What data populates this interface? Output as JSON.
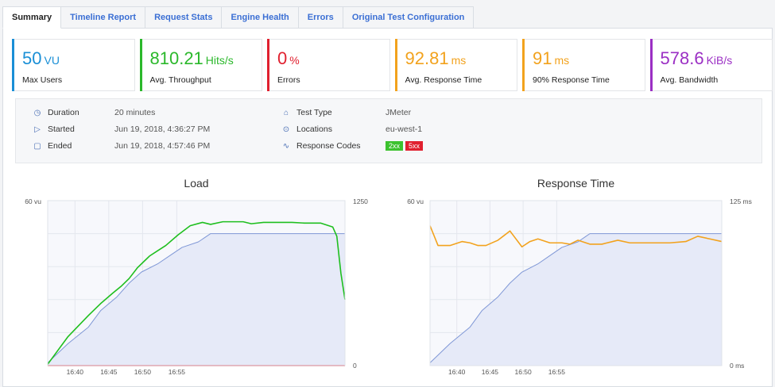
{
  "tabs": [
    {
      "label": "Summary",
      "active": true
    },
    {
      "label": "Timeline Report",
      "active": false
    },
    {
      "label": "Request Stats",
      "active": false
    },
    {
      "label": "Engine Health",
      "active": false
    },
    {
      "label": "Errors",
      "active": false
    },
    {
      "label": "Original Test Configuration",
      "active": false
    }
  ],
  "metrics": [
    {
      "value": "50",
      "unit": "VU",
      "label": "Max Users",
      "color": "#1a8fd6"
    },
    {
      "value": "810.21",
      "unit": "Hits/s",
      "label": "Avg. Throughput",
      "color": "#2bb82b"
    },
    {
      "value": "0",
      "unit": "%",
      "label": "Errors",
      "color": "#e0202f"
    },
    {
      "value": "92.81",
      "unit": "ms",
      "label": "Avg. Response Time",
      "color": "#f2a21d"
    },
    {
      "value": "91",
      "unit": "ms",
      "label": "90% Response Time",
      "color": "#f2a21d"
    },
    {
      "value": "578.6",
      "unit": "KiB/s",
      "label": "Avg. Bandwidth",
      "color": "#9b2fc4"
    }
  ],
  "details": {
    "duration_label": "Duration",
    "duration_value": "20 minutes",
    "started_label": "Started",
    "started_value": "Jun 19, 2018, 4:36:27 PM",
    "ended_label": "Ended",
    "ended_value": "Jun 19, 2018, 4:57:46 PM",
    "test_type_label": "Test Type",
    "test_type_value": "JMeter",
    "locations_label": "Locations",
    "locations_value": "eu-west-1",
    "response_codes_label": "Response Codes",
    "codes": [
      {
        "label": "2xx",
        "color": "#3cc22f"
      },
      {
        "label": "5xx",
        "color": "#e0202f"
      }
    ]
  },
  "chart_data": [
    {
      "type": "line",
      "title": "Load",
      "x_ticks": [
        "16:40",
        "16:45",
        "16:50",
        "16:55"
      ],
      "y_left_label": "60 vu",
      "y_right_top": "1250",
      "y_right_bottom": "0",
      "series": [
        {
          "axis": "left",
          "color": "#7f97d6",
          "fill": "#e6eaf8",
          "points": [
            [
              16.6,
              1
            ],
            [
              16.65,
              8
            ],
            [
              16.7,
              14
            ],
            [
              16.73,
              20
            ],
            [
              16.77,
              25
            ],
            [
              16.8,
              30
            ],
            [
              16.83,
              34
            ],
            [
              16.87,
              37
            ],
            [
              16.9,
              40
            ],
            [
              16.93,
              43
            ],
            [
              16.97,
              45
            ],
            [
              16.99,
              47
            ],
            [
              17.0,
              48
            ],
            [
              17.05,
              48
            ],
            [
              17.1,
              48
            ],
            [
              17.15,
              48
            ],
            [
              17.2,
              48
            ],
            [
              17.25,
              48
            ],
            [
              17.3,
              48
            ],
            [
              17.33,
              48
            ]
          ]
        },
        {
          "axis": "right",
          "color": "#1fbf1f",
          "points": [
            [
              16.6,
              10
            ],
            [
              16.65,
              220
            ],
            [
              16.7,
              380
            ],
            [
              16.73,
              470
            ],
            [
              16.76,
              550
            ],
            [
              16.78,
              600
            ],
            [
              16.8,
              660
            ],
            [
              16.82,
              740
            ],
            [
              16.84,
              800
            ],
            [
              16.85,
              830
            ],
            [
              16.87,
              870
            ],
            [
              16.89,
              910
            ],
            [
              16.92,
              990
            ],
            [
              16.95,
              1060
            ],
            [
              16.98,
              1085
            ],
            [
              17.0,
              1070
            ],
            [
              17.03,
              1090
            ],
            [
              17.05,
              1090
            ],
            [
              17.08,
              1090
            ],
            [
              17.1,
              1075
            ],
            [
              17.13,
              1085
            ],
            [
              17.17,
              1085
            ],
            [
              17.2,
              1085
            ],
            [
              17.23,
              1080
            ],
            [
              17.27,
              1080
            ],
            [
              17.3,
              1050
            ],
            [
              17.31,
              980
            ],
            [
              17.32,
              700
            ],
            [
              17.33,
              500
            ]
          ]
        },
        {
          "axis": "right",
          "color": "#e03040",
          "points": [
            [
              16.6,
              0
            ],
            [
              17.33,
              0
            ]
          ]
        }
      ]
    },
    {
      "type": "line",
      "title": "Response Time",
      "x_ticks": [
        "16:40",
        "16:45",
        "16:50",
        "16:55"
      ],
      "y_left_label": "60 vu",
      "y_right_top": "125 ms",
      "y_right_bottom": "0 ms",
      "series": [
        {
          "axis": "left",
          "color": "#7f97d6",
          "fill": "#e6eaf8",
          "points": [
            [
              16.6,
              1
            ],
            [
              16.65,
              8
            ],
            [
              16.7,
              14
            ],
            [
              16.73,
              20
            ],
            [
              16.77,
              25
            ],
            [
              16.8,
              30
            ],
            [
              16.83,
              34
            ],
            [
              16.87,
              37
            ],
            [
              16.9,
              40
            ],
            [
              16.93,
              43
            ],
            [
              16.97,
              45
            ],
            [
              16.99,
              47
            ],
            [
              17.0,
              48
            ],
            [
              17.05,
              48
            ],
            [
              17.1,
              48
            ],
            [
              17.15,
              48
            ],
            [
              17.2,
              48
            ],
            [
              17.25,
              48
            ],
            [
              17.3,
              48
            ],
            [
              17.33,
              48
            ]
          ]
        },
        {
          "axis": "right",
          "color": "#f2a21d",
          "points": [
            [
              16.6,
              106
            ],
            [
              16.62,
              91
            ],
            [
              16.65,
              91
            ],
            [
              16.68,
              94
            ],
            [
              16.7,
              93
            ],
            [
              16.72,
              91
            ],
            [
              16.74,
              91
            ],
            [
              16.77,
              95
            ],
            [
              16.8,
              102
            ],
            [
              16.81,
              98
            ],
            [
              16.83,
              90
            ],
            [
              16.85,
              94
            ],
            [
              16.87,
              96
            ],
            [
              16.9,
              93
            ],
            [
              16.93,
              93
            ],
            [
              16.95,
              92
            ],
            [
              16.97,
              95
            ],
            [
              17.0,
              92
            ],
            [
              17.03,
              92
            ],
            [
              17.07,
              95
            ],
            [
              17.1,
              93
            ],
            [
              17.15,
              93
            ],
            [
              17.2,
              93
            ],
            [
              17.24,
              94
            ],
            [
              17.27,
              98
            ],
            [
              17.3,
              96
            ],
            [
              17.33,
              94
            ]
          ]
        }
      ]
    }
  ]
}
